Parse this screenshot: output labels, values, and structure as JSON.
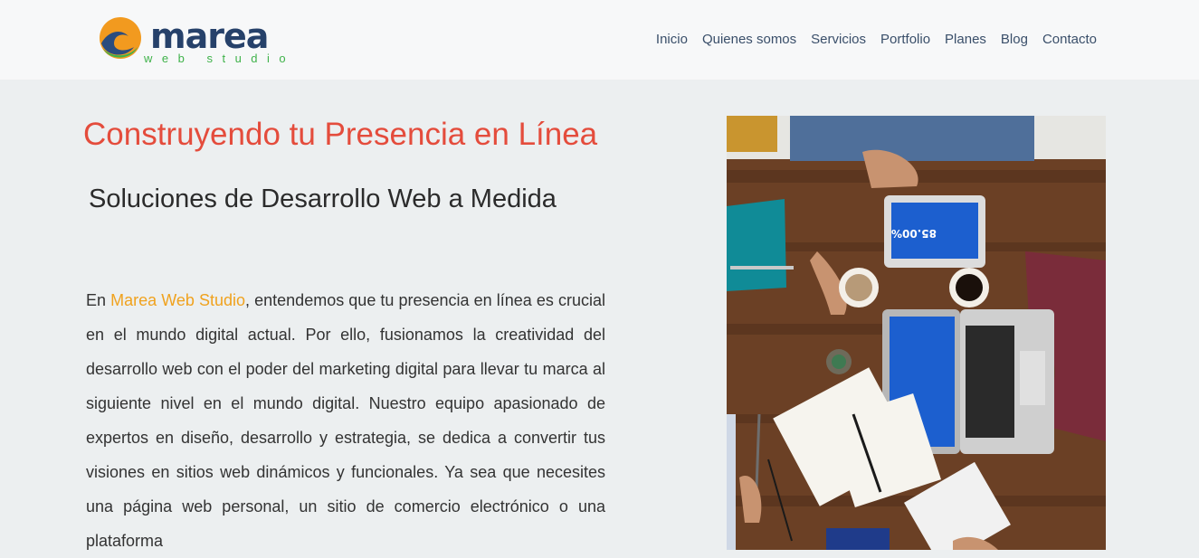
{
  "header": {
    "logo": {
      "word": "marea",
      "sub": "web studio"
    },
    "nav": [
      "Inicio",
      "Quienes somos",
      "Servicios",
      "Portfolio",
      "Planes",
      "Blog",
      "Contacto"
    ]
  },
  "hero": {
    "title": "Construyendo tu Presencia en Línea",
    "subtitle": "Soluciones de Desarrollo Web a Medida",
    "intro_prefix": "En ",
    "intro_brand": "Marea Web Studio",
    "intro_text": ", entendemos que tu presencia en línea es crucial en el mundo digital actual. Por ello, fusionamos la creatividad del desarrollo web con el poder del marketing digital para llevar tu marca al siguiente nivel en el mundo digital. Nuestro equipo apasionado de expertos en diseño, desarrollo y estrategia, se dedica a convertir tus visiones en sitios web dinámicos y funcionales. Ya sea que necesites una página web personal, un sitio de comercio electrónico o una plataforma"
  },
  "photo": {
    "tablet_value": "85.00%",
    "colors": {
      "table": "#6b4025",
      "screen": "#1c5fcf"
    }
  }
}
